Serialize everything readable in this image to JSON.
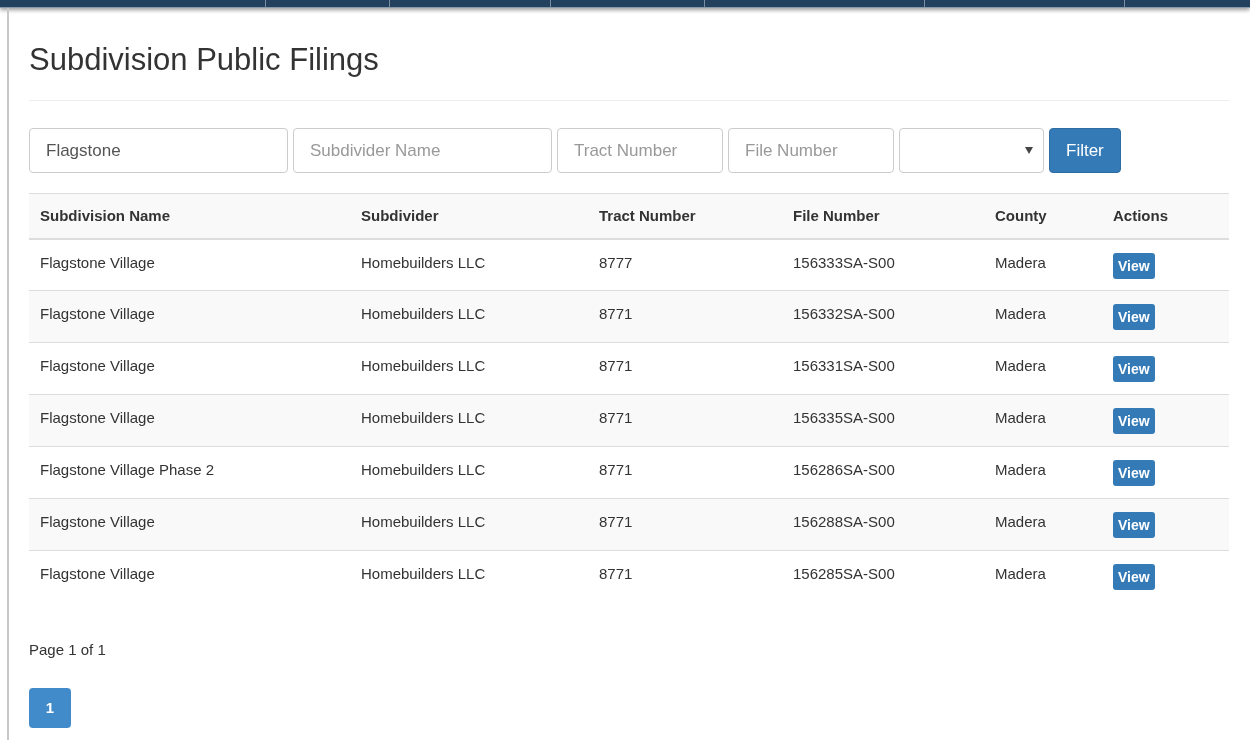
{
  "title": "Subdivision Public Filings",
  "filters": [
    {
      "kind": "input",
      "value": "Flagstone"
    },
    {
      "kind": "input",
      "placeholder": "Subdivider Name"
    },
    {
      "kind": "input",
      "placeholder": "Tract Number"
    },
    {
      "kind": "input",
      "placeholder": "File Number"
    },
    {
      "kind": "select"
    },
    {
      "kind": "button",
      "label": "Filter"
    }
  ],
  "table": {
    "columns": [
      "Subdivision Name",
      "Subdivider",
      "Tract Number",
      "File Number",
      "County",
      "Actions"
    ],
    "rows": [
      {
        "cells": [
          "Flagstone Village",
          "Homebuilders LLC",
          "8777",
          "156333SA-S00",
          "Madera"
        ],
        "action": "View"
      },
      {
        "cells": [
          "Flagstone Village",
          "Homebuilders LLC",
          "8771",
          "156332SA-S00",
          "Madera"
        ],
        "action": "View"
      },
      {
        "cells": [
          "Flagstone Village",
          "Homebuilders LLC",
          "8771",
          "156331SA-S00",
          "Madera"
        ],
        "action": "View"
      },
      {
        "cells": [
          "Flagstone Village",
          "Homebuilders LLC",
          "8771",
          "156335SA-S00",
          "Madera"
        ],
        "action": "View"
      },
      {
        "cells": [
          "Flagstone Village Phase 2",
          "Homebuilders LLC",
          "8771",
          "156286SA-S00",
          "Madera"
        ],
        "action": "View"
      },
      {
        "cells": [
          "Flagstone Village",
          "Homebuilders LLC",
          "8771",
          "156288SA-S00",
          "Madera"
        ],
        "action": "View"
      },
      {
        "cells": [
          "Flagstone Village",
          "Homebuilders LLC",
          "8771",
          "156285SA-S00",
          "Madera"
        ],
        "action": "View"
      }
    ]
  },
  "page_info": "Page 1 of 1",
  "pagination": [
    {
      "label": "1",
      "selected": true
    }
  ]
}
